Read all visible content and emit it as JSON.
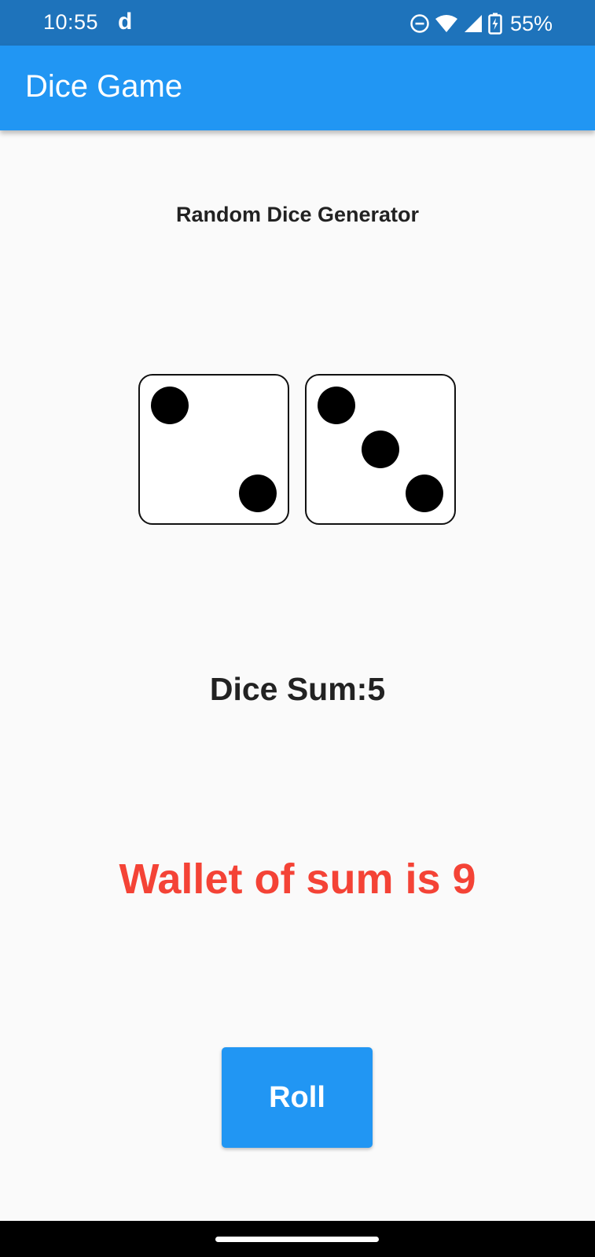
{
  "status_bar": {
    "time": "10:55",
    "app_indicator": "d",
    "battery_percent": "55%",
    "icons": [
      "do-not-disturb-icon",
      "wifi-icon",
      "cell-signal-icon",
      "battery-charging-icon"
    ]
  },
  "app_bar": {
    "title": "Dice Game",
    "color": "#2196f3"
  },
  "main": {
    "subtitle": "Random Dice Generator",
    "dice": [
      {
        "name": "left-die",
        "value": 2
      },
      {
        "name": "right-die",
        "value": 3
      }
    ],
    "dice_sum_text": "Dice Sum:5",
    "wallet_text": "Wallet of sum is 9",
    "wallet_color": "#f44336",
    "roll_label": "Roll"
  }
}
